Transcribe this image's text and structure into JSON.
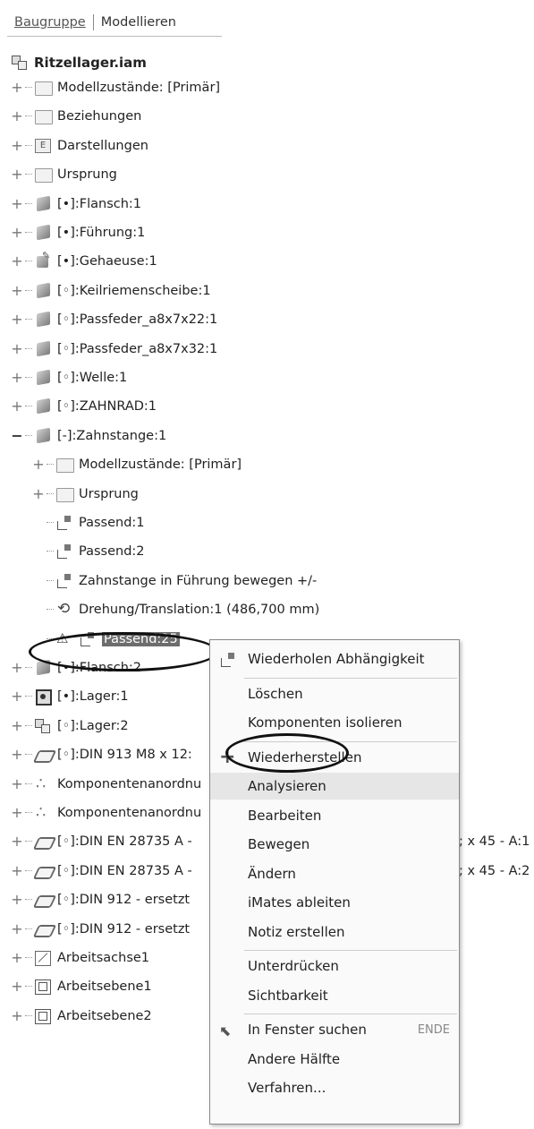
{
  "tabs": {
    "assembly": "Baugruppe",
    "modeling": "Modellieren"
  },
  "root": {
    "label": "Ritzellager.iam",
    "icon": "assembly-icon"
  },
  "tree": [
    {
      "label": "Modellzustände: [Primär]",
      "icon": "folder-icon",
      "indent": 0,
      "expander": "+"
    },
    {
      "label": "Beziehungen",
      "icon": "folder-icon",
      "indent": 0,
      "expander": "+"
    },
    {
      "label": "Darstellungen",
      "icon": "representations-icon",
      "indent": 0,
      "expander": "+"
    },
    {
      "label": "Ursprung",
      "icon": "folder-icon",
      "indent": 0,
      "expander": "+"
    },
    {
      "label": "[•]:Flansch:1",
      "icon": "part-icon",
      "indent": 0,
      "expander": "+"
    },
    {
      "label": "[•]:Führung:1",
      "icon": "part-icon",
      "indent": 0,
      "expander": "+"
    },
    {
      "label": "[•]:Gehaeuse:1",
      "icon": "modified-part-icon",
      "indent": 0,
      "expander": "+"
    },
    {
      "label": "[◦]:Keilriemenscheibe:1",
      "icon": "part-icon",
      "indent": 0,
      "expander": "+"
    },
    {
      "label": "[◦]:Passfeder_a8x7x22:1",
      "icon": "part-icon",
      "indent": 0,
      "expander": "+"
    },
    {
      "label": "[◦]:Passfeder_a8x7x32:1",
      "icon": "part-icon",
      "indent": 0,
      "expander": "+"
    },
    {
      "label": "[◦]:Welle:1",
      "icon": "part-icon",
      "indent": 0,
      "expander": "+"
    },
    {
      "label": "[◦]:ZAHNRAD:1",
      "icon": "part-icon",
      "indent": 0,
      "expander": "+"
    },
    {
      "label": "[-]:Zahnstange:1",
      "icon": "part-icon",
      "indent": 0,
      "expander": "−"
    },
    {
      "label": "Modellzustände: [Primär]",
      "icon": "folder-icon",
      "indent": 1,
      "expander": "+"
    },
    {
      "label": "Ursprung",
      "icon": "folder-icon",
      "indent": 1,
      "expander": "+"
    },
    {
      "label": "Passend:1",
      "icon": "constraint-icon",
      "indent": 1,
      "expander": ""
    },
    {
      "label": "Passend:2",
      "icon": "constraint-icon",
      "indent": 1,
      "expander": ""
    },
    {
      "label": "Zahnstange in Führung bewegen +/-",
      "icon": "constraint-icon",
      "indent": 1,
      "expander": ""
    },
    {
      "label": "Drehung/Translation:1 (486,700 mm)",
      "icon": "drive-constraint-icon",
      "indent": 1,
      "expander": ""
    },
    {
      "label": "Passend:25",
      "icon": "constraint-icon",
      "indent": 1,
      "expander": "",
      "warning": true,
      "selected": true
    },
    {
      "label": "[•]:Flansch:2",
      "icon": "part-icon",
      "indent": 0,
      "expander": "+"
    },
    {
      "label": "[•]:Lager:1",
      "icon": "bearing-icon",
      "indent": 0,
      "expander": "+"
    },
    {
      "label": "[◦]:Lager:2",
      "icon": "assembly-icon",
      "indent": 0,
      "expander": "+"
    },
    {
      "label": "[◦]:DIN 913 M8 x 12:",
      "icon": "bolt-icon",
      "indent": 0,
      "expander": "+"
    },
    {
      "label": "Komponentenanordnu",
      "icon": "pattern-icon",
      "indent": 0,
      "expander": "+"
    },
    {
      "label": "Komponentenanordnu",
      "icon": "pattern-icon",
      "indent": 0,
      "expander": "+"
    },
    {
      "label": "[◦]:DIN EN 28735 A -",
      "icon": "bolt-icon",
      "indent": 0,
      "expander": "+",
      "tail": "; x 45 - A:1"
    },
    {
      "label": "[◦]:DIN EN 28735 A -",
      "icon": "bolt-icon",
      "indent": 0,
      "expander": "+",
      "tail": "; x 45 - A:2"
    },
    {
      "label": "[◦]:DIN 912 - ersetzt",
      "icon": "bolt-icon",
      "indent": 0,
      "expander": "+"
    },
    {
      "label": "[◦]:DIN 912 - ersetzt",
      "icon": "bolt-icon",
      "indent": 0,
      "expander": "+"
    },
    {
      "label": "Arbeitsachse1",
      "icon": "work-axis-icon",
      "indent": 0,
      "expander": "+"
    },
    {
      "label": "Arbeitsebene1",
      "icon": "work-plane-icon",
      "indent": 0,
      "expander": "+"
    },
    {
      "label": "Arbeitsebene2",
      "icon": "work-plane-icon",
      "indent": 0,
      "expander": "+"
    }
  ],
  "context_menu": [
    {
      "label": "Wiederholen Abhängigkeit",
      "icon": "constraint-icon",
      "shortcut": ""
    },
    {
      "label": "Löschen",
      "icon": "",
      "shortcut": ""
    },
    {
      "label": "Komponenten isolieren",
      "icon": "",
      "shortcut": ""
    },
    {
      "label": "Wiederherstellen",
      "icon": "plus-icon",
      "shortcut": ""
    },
    {
      "label": "Analysieren",
      "icon": "",
      "shortcut": "",
      "highlighted": true
    },
    {
      "label": "Bearbeiten",
      "icon": "",
      "shortcut": ""
    },
    {
      "label": "Bewegen",
      "icon": "",
      "shortcut": ""
    },
    {
      "label": "Ändern",
      "icon": "",
      "shortcut": ""
    },
    {
      "label": "iMates ableiten",
      "icon": "",
      "shortcut": ""
    },
    {
      "label": "Notiz erstellen",
      "icon": "",
      "shortcut": ""
    },
    {
      "label": "Unterdrücken",
      "icon": "",
      "shortcut": ""
    },
    {
      "label": "Sichtbarkeit",
      "icon": "",
      "shortcut": ""
    },
    {
      "label": "In Fenster suchen",
      "icon": "find-cursor-icon",
      "shortcut": "ENDE"
    },
    {
      "label": "Andere Hälfte",
      "icon": "",
      "shortcut": ""
    },
    {
      "label": "Verfahren...",
      "icon": "",
      "shortcut": ""
    }
  ]
}
